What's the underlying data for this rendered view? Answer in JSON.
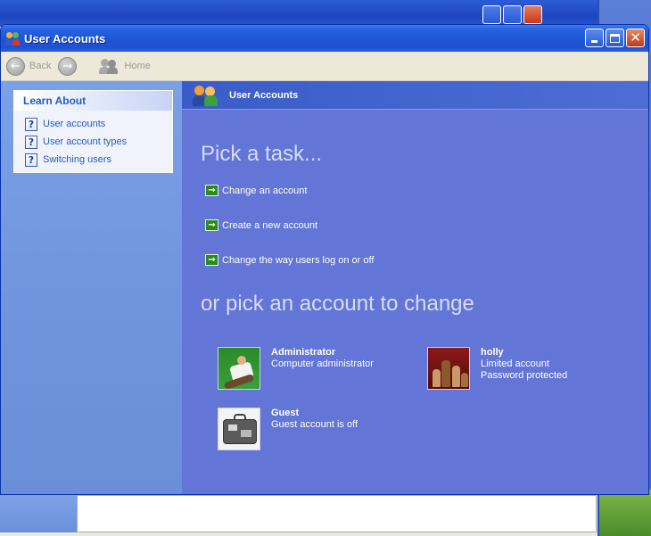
{
  "window": {
    "title": "User Accounts"
  },
  "toolbar": {
    "back_label": "Back",
    "home_label": "Home"
  },
  "sidebar": {
    "learn_about": {
      "title": "Learn About",
      "items": [
        {
          "label": "User accounts"
        },
        {
          "label": "User account types"
        },
        {
          "label": "Switching users"
        }
      ]
    }
  },
  "main": {
    "header_title": "User Accounts",
    "pick_task_heading": "Pick a task...",
    "tasks": [
      {
        "label": "Change an account"
      },
      {
        "label": "Create a new account"
      },
      {
        "label": "Change the way users log on or off"
      }
    ],
    "pick_account_heading": "or pick an account to change",
    "accounts": [
      {
        "name": "Administrator",
        "lines": [
          "Computer administrator"
        ],
        "picture": "skateboard-picture"
      },
      {
        "name": "holly",
        "lines": [
          "Limited account",
          "Password protected"
        ],
        "picture": "chess-picture"
      },
      {
        "name": "Guest",
        "lines": [
          "Guest account is off"
        ],
        "picture": "briefcase-picture"
      }
    ]
  },
  "colors": {
    "title_bar": "#1f55d8",
    "sidebar": "#6f93dc",
    "main_panel": "#6375d6",
    "link": "#215dc6",
    "heading": "#d6ddf6"
  }
}
